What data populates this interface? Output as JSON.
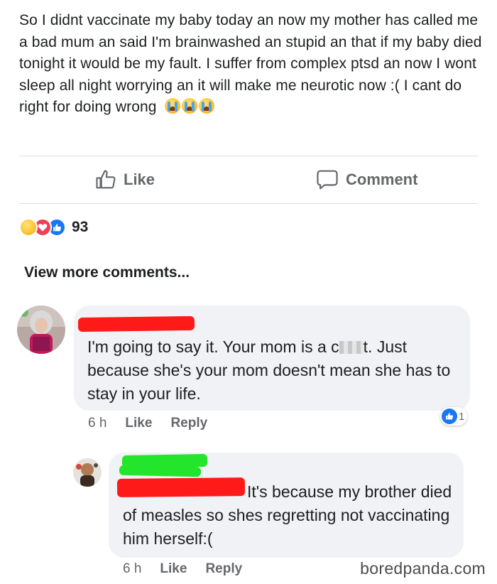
{
  "post": {
    "text": "So I didnt vaccinate my baby today an now my mother has called me a bad mum an said I'm brainwashed an stupid an that if my baby died tonight it would be my fault. I suffer from complex ptsd an now I wont sleep all night worrying an it will make me neurotic now :( I cant do right for doing wrong",
    "emoji": [
      "crying-face-icon",
      "crying-face-icon",
      "crying-face-icon"
    ]
  },
  "actions": {
    "like_label": "Like",
    "comment_label": "Comment"
  },
  "reactions": {
    "icons": [
      "sad-reaction-icon",
      "love-reaction-icon",
      "like-reaction-icon"
    ],
    "count": "93"
  },
  "view_more_label": "View more comments...",
  "comments": [
    {
      "text_before": "I'm going to say it. Your mom is a c",
      "text_after": "t. Just because she's your mom doesn't mean she has to stay in your life.",
      "time": "6 h",
      "like_label": "Like",
      "reply_label": "Reply",
      "reaction_count": "1"
    },
    {
      "text": "It's because my brother died of measles so shes regretting not vaccinating him herself:(",
      "time": "6 h",
      "like_label": "Like",
      "reply_label": "Reply"
    }
  ],
  "watermark": "boredpanda.com",
  "colors": {
    "like_blue": "#1877f2",
    "love_red": "#f33e58",
    "bubble_bg": "#f0f2f5",
    "redaction_red": "#ff1a1a",
    "redaction_green": "#23e52b",
    "meta_gray": "#65676b"
  }
}
